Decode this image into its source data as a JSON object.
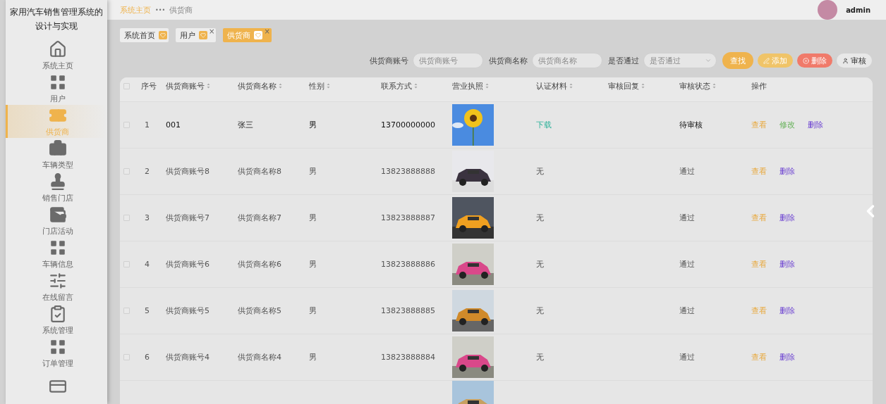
{
  "sidebar": {
    "title": "家用汽车销售管理系统的设计与实现",
    "items": [
      {
        "label": "系统主页",
        "selected": false
      },
      {
        "label": "用户",
        "selected": false
      },
      {
        "label": "供货商",
        "selected": true
      },
      {
        "label": "车辆类型",
        "selected": false
      },
      {
        "label": "销售门店",
        "selected": false
      },
      {
        "label": "门店活动",
        "selected": false
      },
      {
        "label": "车辆信息",
        "selected": false
      },
      {
        "label": "在线留言",
        "selected": false
      },
      {
        "label": "系统管理",
        "selected": false
      },
      {
        "label": "订单管理",
        "selected": false
      },
      {
        "selected": false
      }
    ]
  },
  "breadcrumb": [
    {
      "label": "系统主页",
      "selected": false
    },
    {
      "label": "供货商",
      "selected": true
    }
  ],
  "breadcrumb_separator": "•••",
  "user": {
    "name": "admin"
  },
  "tags": [
    {
      "label": "系统首页",
      "selected": false,
      "closable": false
    },
    {
      "label": "用户",
      "selected": false,
      "closable": true
    },
    {
      "label": "供货商",
      "selected": true,
      "closable": true
    }
  ],
  "tag_close": "×",
  "search": {
    "fields": [
      {
        "label": "供货商账号",
        "placeholder": "供货商账号",
        "kind": "input"
      },
      {
        "label": "供货商名称",
        "placeholder": "供货商名称",
        "kind": "input"
      },
      {
        "label": "是否通过",
        "placeholder": "是否通过",
        "kind": "select"
      }
    ],
    "buttons": [
      {
        "label": "查找",
        "kind": "search"
      },
      {
        "label": "添加",
        "kind": "add"
      },
      {
        "label": "删除",
        "kind": "delete"
      },
      {
        "label": "审核",
        "kind": "review"
      }
    ]
  },
  "table": {
    "header_checked": false,
    "columns": [
      {
        "label": "序号",
        "sortable": false
      },
      {
        "label": "供货商账号",
        "sortable": true
      },
      {
        "label": "供货商名称",
        "sortable": true
      },
      {
        "label": "性别",
        "sortable": true
      },
      {
        "label": "联系方式",
        "sortable": true
      },
      {
        "label": "营业执照",
        "sortable": true
      },
      {
        "label": "认证材料",
        "sortable": true
      },
      {
        "label": "审核回复",
        "sortable": true
      },
      {
        "label": "审核状态",
        "sortable": true
      },
      {
        "label": "操作",
        "sortable": false
      }
    ],
    "rows": [
      {
        "checked": false,
        "index": "1",
        "account": "001",
        "name": "张三",
        "gender": "男",
        "phone": "13700000000",
        "license": {
          "kind": "picture"
        },
        "material": {
          "text": "下载",
          "kind": "link"
        },
        "status": "待审核",
        "pending": true,
        "actions": [
          {
            "label": "查看",
            "kind": "view"
          },
          {
            "label": "修改",
            "kind": "edit"
          },
          {
            "label": "删除",
            "kind": "delete"
          }
        ]
      },
      {
        "checked": false,
        "index": "2",
        "account": "供货商账号8",
        "name": "供货商名称8",
        "gender": "男",
        "phone": "13823888888",
        "license": {
          "kind": "picture"
        },
        "material": {
          "text": "无",
          "kind": "text"
        },
        "status": "通过",
        "pending": false,
        "actions": [
          {
            "label": "查看",
            "kind": "view"
          },
          {
            "label": "删除",
            "kind": "delete"
          }
        ]
      },
      {
        "checked": false,
        "index": "3",
        "account": "供货商账号7",
        "name": "供货商名称7",
        "gender": "男",
        "phone": "13823888887",
        "license": {
          "kind": "picture"
        },
        "material": {
          "text": "无",
          "kind": "text"
        },
        "status": "通过",
        "pending": false,
        "actions": [
          {
            "label": "查看",
            "kind": "view"
          },
          {
            "label": "删除",
            "kind": "delete"
          }
        ]
      },
      {
        "checked": false,
        "index": "4",
        "account": "供货商账号6",
        "name": "供货商名称6",
        "gender": "男",
        "phone": "13823888886",
        "license": {
          "kind": "picture"
        },
        "material": {
          "text": "无",
          "kind": "text"
        },
        "status": "通过",
        "pending": false,
        "actions": [
          {
            "label": "查看",
            "kind": "view"
          },
          {
            "label": "删除",
            "kind": "delete"
          }
        ]
      },
      {
        "checked": false,
        "index": "5",
        "account": "供货商账号5",
        "name": "供货商名称5",
        "gender": "男",
        "phone": "13823888885",
        "license": {
          "kind": "picture"
        },
        "material": {
          "text": "无",
          "kind": "text"
        },
        "status": "通过",
        "pending": false,
        "actions": [
          {
            "label": "查看",
            "kind": "view"
          },
          {
            "label": "删除",
            "kind": "delete"
          }
        ]
      },
      {
        "checked": false,
        "index": "6",
        "account": "供货商账号4",
        "name": "供货商名称4",
        "gender": "男",
        "phone": "13823888884",
        "license": {
          "kind": "picture"
        },
        "material": {
          "text": "无",
          "kind": "text"
        },
        "status": "通过",
        "pending": false,
        "actions": [
          {
            "label": "查看",
            "kind": "view"
          },
          {
            "label": "删除",
            "kind": "delete"
          }
        ]
      },
      {
        "license": {
          "kind": "picture"
        }
      }
    ]
  }
}
